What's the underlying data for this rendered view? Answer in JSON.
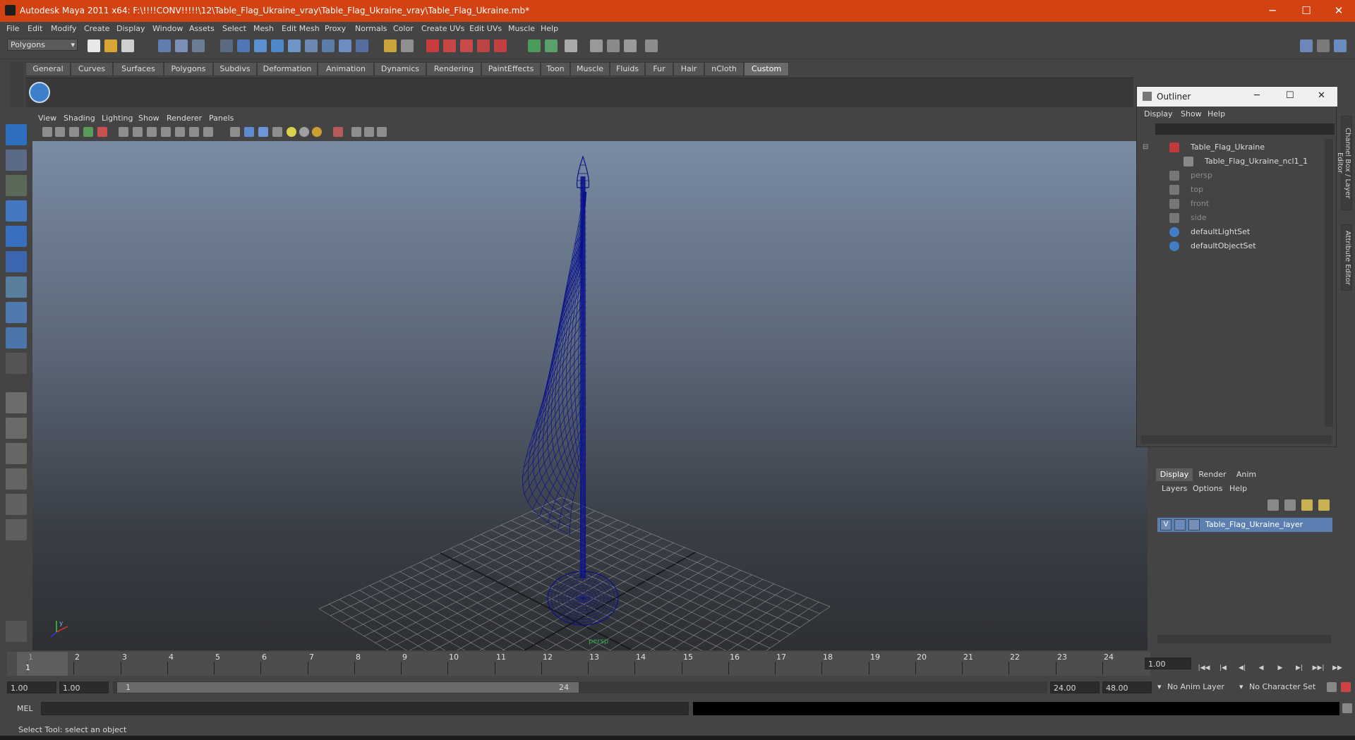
{
  "window": {
    "title": "Autodesk Maya 2011 x64: F:\\!!!!CONV!!!!!\\12\\Table_Flag_Ukraine_vray\\Table_Flag_Ukraine_vray\\Table_Flag_Ukraine.mb*",
    "minimize": "─",
    "maximize": "☐",
    "close": "✕"
  },
  "menubar": [
    "File",
    "Edit",
    "Modify",
    "Create",
    "Display",
    "Window",
    "Assets",
    "Select",
    "Mesh",
    "Edit Mesh",
    "Proxy",
    "Normals",
    "Color",
    "Create UVs",
    "Edit UVs",
    "Muscle",
    "Help"
  ],
  "statusline": {
    "mode": "Polygons",
    "mode_arrow": "▾"
  },
  "shelf": {
    "tabs": [
      "General",
      "Curves",
      "Surfaces",
      "Polygons",
      "Subdivs",
      "Deformation",
      "Animation",
      "Dynamics",
      "Rendering",
      "PaintEffects",
      "Toon",
      "Muscle",
      "Fluids",
      "Fur",
      "Hair",
      "nCloth",
      "Custom"
    ],
    "active_tab": "Custom"
  },
  "panel_menu": [
    "View",
    "Shading",
    "Lighting",
    "Show",
    "Renderer",
    "Panels"
  ],
  "viewport": {
    "camera_label": "persp",
    "axis": {
      "x": "x",
      "y": "y"
    }
  },
  "outliner": {
    "title": "Outliner",
    "menu": [
      "Display",
      "Show",
      "Help"
    ],
    "items": [
      {
        "label": "Table_Flag_Ukraine",
        "dim": false,
        "icon": "transform-icon"
      },
      {
        "label": "Table_Flag_Ukraine_ncl1_1",
        "dim": false,
        "icon": "mesh-icon"
      },
      {
        "label": "persp",
        "dim": true,
        "icon": "camera-icon"
      },
      {
        "label": "top",
        "dim": true,
        "icon": "camera-icon"
      },
      {
        "label": "front",
        "dim": true,
        "icon": "camera-icon"
      },
      {
        "label": "side",
        "dim": true,
        "icon": "camera-icon"
      },
      {
        "label": "defaultLightSet",
        "dim": false,
        "icon": "set-icon"
      },
      {
        "label": "defaultObjectSet",
        "dim": false,
        "icon": "set-icon"
      }
    ],
    "collapse": "⊟"
  },
  "side_tabs": {
    "channel_box": "Channel Box / Layer Editor",
    "attribute_editor": "Attribute Editor"
  },
  "layers": {
    "tabs": [
      "Display",
      "Render",
      "Anim"
    ],
    "active_tab": "Display",
    "menu": [
      "Layers",
      "Options",
      "Help"
    ],
    "rows": [
      {
        "visible": "V",
        "name": "Table_Flag_Ukraine_layer"
      }
    ]
  },
  "timeslider": {
    "ticks": [
      "1",
      "2",
      "3",
      "4",
      "5",
      "6",
      "7",
      "8",
      "9",
      "10",
      "11",
      "12",
      "13",
      "14",
      "15",
      "16",
      "17",
      "18",
      "19",
      "20",
      "21",
      "22",
      "23",
      "24"
    ],
    "current_frame": "1",
    "current_time_field": "1.00"
  },
  "playback": [
    "|◀◀",
    "|◀",
    "◀|",
    "◀",
    "▶",
    "▶|",
    "▶▶|",
    "▶▶"
  ],
  "range": {
    "start": "1.00",
    "playback_start": "1.00",
    "range_start_label": "1",
    "range_end_label": "24",
    "playback_end": "24.00",
    "end": "48.00",
    "anim_layer": "No Anim Layer",
    "character_set": "No Character Set"
  },
  "cmdline": {
    "label": "MEL",
    "value": "",
    "result": ""
  },
  "helpline": {
    "text": "Select Tool: select an object"
  },
  "colors": {
    "titlebar": "#d34212",
    "wireframe": "#0a128c",
    "selection_blue": "#5a7fb0",
    "grid": "#9a9a9a"
  }
}
